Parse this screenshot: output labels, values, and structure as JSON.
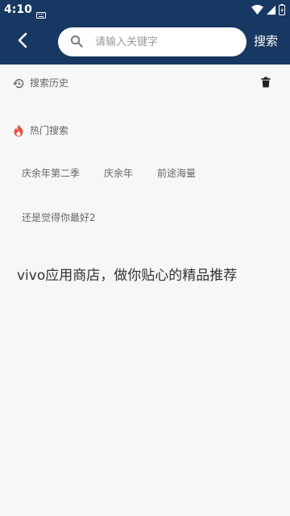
{
  "status_bar": {
    "time": "4:10"
  },
  "search": {
    "placeholder": "请输入关键字",
    "button_label": "搜索"
  },
  "history": {
    "title": "搜索历史"
  },
  "hot": {
    "title": "热门搜索",
    "tags": [
      "庆余年第二季",
      "庆余年",
      "前途海量",
      "还是觉得你最好2"
    ]
  },
  "slogan": "vivo应用商店，做你贴心的精品推荐",
  "colors": {
    "primary": "#163862",
    "background": "#f7f7f7",
    "hot_icon": "#e8523d"
  }
}
